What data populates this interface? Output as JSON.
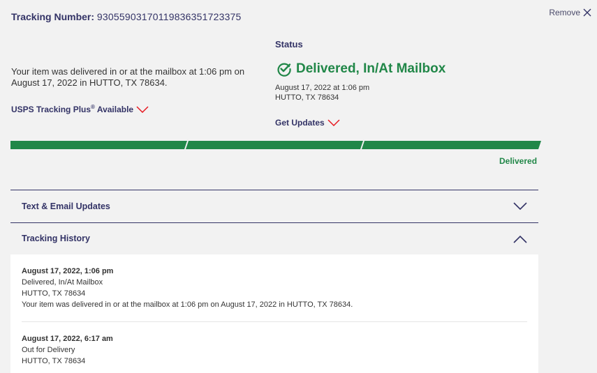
{
  "tracking": {
    "label": "Tracking Number:",
    "number": "9305590317011983635172337​5"
  },
  "remove_label": "Remove",
  "summary_text": "Your item was delivered in or at the mailbox at 1:06 pm on August 17, 2022 in HUTTO, TX 78634.",
  "tracking_plus": {
    "label": "USPS Tracking Plus",
    "sup": "®",
    "suffix": " Available"
  },
  "status": {
    "heading": "Status",
    "main": "Delivered, In/At Mailbox",
    "date": "August 17, 2022 at 1:06 pm",
    "location": "HUTTO, TX 78634"
  },
  "get_updates_label": "Get Updates",
  "progress": {
    "segments_complete": 3,
    "segments_total": 3,
    "end_label": "Delivered"
  },
  "accordions": {
    "text_email": "Text & Email Updates",
    "history": "Tracking History"
  },
  "history": [
    {
      "date": "August 17, 2022, 1:06 pm",
      "status": "Delivered, In/At Mailbox",
      "location": "HUTTO, TX 78634",
      "detail": "Your item was delivered in or at the mailbox at 1:06 pm on August 17, 2022 in HUTTO, TX 78634."
    },
    {
      "date": "August 17, 2022, 6:17 am",
      "status": "Out for Delivery",
      "location": "HUTTO, TX 78634"
    }
  ],
  "colors": {
    "navy": "#333366",
    "green": "#218748",
    "red": "#e71921",
    "background": "#f2f2f2"
  },
  "icons": {
    "remove": "close-x-icon",
    "status": "check-circle-icon",
    "chevron_down": "chevron-down-icon",
    "chevron_up": "chevron-up-icon"
  }
}
